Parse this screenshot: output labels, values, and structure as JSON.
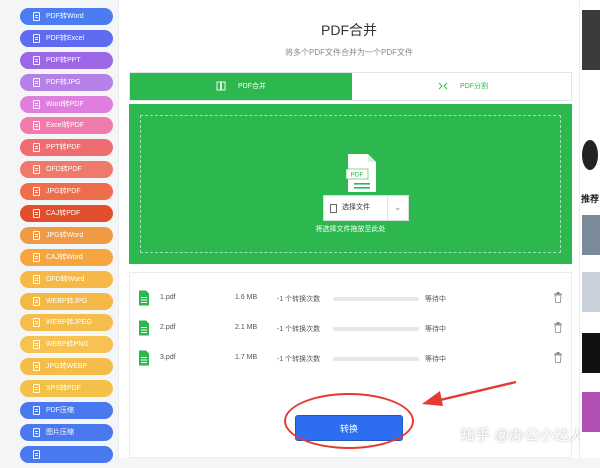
{
  "sidebar": {
    "items": [
      {
        "label": "PDF转Word",
        "color": "#4b7cf2"
      },
      {
        "label": "PDF转Excel",
        "color": "#5f6bf0"
      },
      {
        "label": "PDF转PPT",
        "color": "#9b67e6"
      },
      {
        "label": "PDF转JPG",
        "color": "#b581e8"
      },
      {
        "label": "Word转PDF",
        "color": "#e07ee0"
      },
      {
        "label": "Excel转PDF",
        "color": "#ef7cab"
      },
      {
        "label": "PPT转PDF",
        "color": "#ee6d70"
      },
      {
        "label": "OFD转PDF",
        "color": "#ee7a6b"
      },
      {
        "label": "JPG转PDF",
        "color": "#ee6e4c"
      },
      {
        "label": "CAJ转PDF",
        "color": "#e14e2b"
      },
      {
        "label": "JPG转Word",
        "color": "#f09a45"
      },
      {
        "label": "CAJ转Word",
        "color": "#f5a641"
      },
      {
        "label": "OFD转Word",
        "color": "#f6b947"
      },
      {
        "label": "WEBP转JPG",
        "color": "#f3b846"
      },
      {
        "label": "WEBP转JPEG",
        "color": "#f5bd4c"
      },
      {
        "label": "WEBP转PNG",
        "color": "#f7c24f"
      },
      {
        "label": "JPG转WEBP",
        "color": "#f4bd47"
      },
      {
        "label": "XPS转PDF",
        "color": "#f3c147"
      },
      {
        "label": "PDF压缩",
        "color": "#4a78ee"
      },
      {
        "label": "图片压缩",
        "color": "#4a78ee"
      },
      {
        "label": "",
        "color": "#4a78ee"
      }
    ]
  },
  "main": {
    "title": "PDF合并",
    "subtitle": "将多个PDF文件合并为一个PDF文件",
    "tabs": [
      {
        "label": "PDF合并",
        "active": true
      },
      {
        "label": "PDF分割",
        "active": false
      }
    ],
    "dropzone": {
      "icon_text": "PDF",
      "select_label": "选择文件",
      "hint": "将选择文件拖放至此处"
    },
    "files": [
      {
        "name": "1.pdf",
        "size": "1.6 MB",
        "count": "-1 个转换次数",
        "progress": 0,
        "status": "等待中"
      },
      {
        "name": "2.pdf",
        "size": "2.1 MB",
        "count": "-1 个转换次数",
        "progress": 0,
        "status": "等待中"
      },
      {
        "name": "3.pdf",
        "size": "1.7 MB",
        "count": "-1 个转换次数",
        "progress": 0,
        "status": "等待中"
      }
    ],
    "convert_label": "转换"
  },
  "right_panel": {
    "recommend_label": "推荐"
  },
  "watermark": "知乎 @办公小达人",
  "colors": {
    "accent_green": "#2db84f",
    "button_blue": "#2d6ef0",
    "annotation_red": "#e53a31"
  }
}
